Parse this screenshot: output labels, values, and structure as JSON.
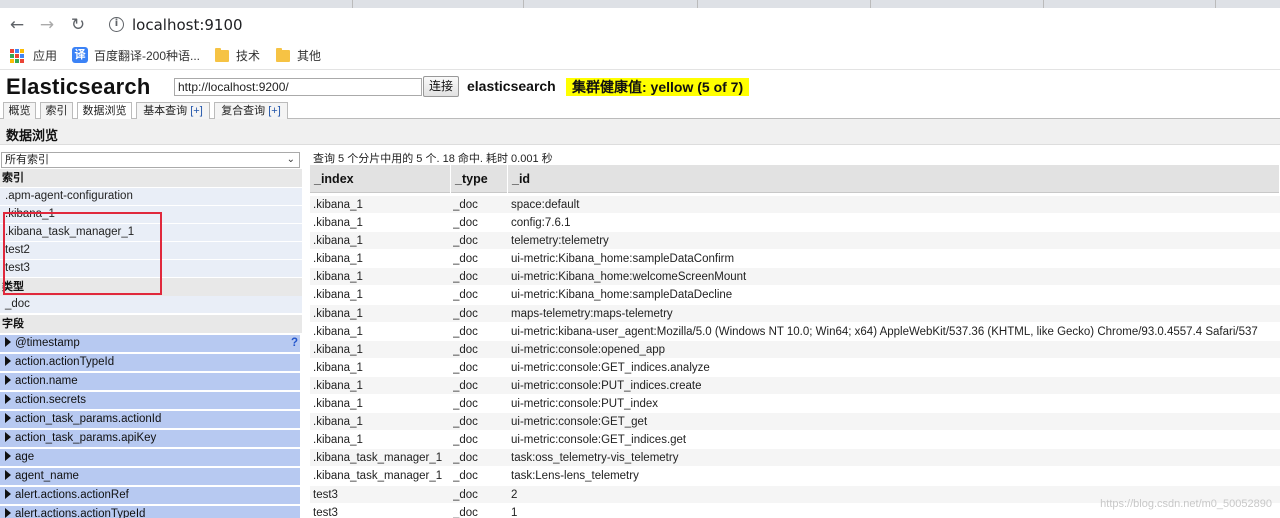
{
  "browser": {
    "back_icon": "arrow-left-icon",
    "forward_icon": "arrow-right-icon",
    "reload_icon": "reload-icon",
    "url": "localhost:9100",
    "bookmarks": [
      {
        "label": "应用",
        "icon": "apps-grid-icon"
      },
      {
        "label": "百度翻译-200种语...",
        "icon": "fanyi-icon"
      },
      {
        "label": "技术",
        "icon": "folder-icon"
      },
      {
        "label": "其他",
        "icon": "folder-icon"
      }
    ]
  },
  "header": {
    "logo": "Elasticsearch",
    "connect_url": "http://localhost:9200/",
    "connect_button": "连接",
    "cluster_name": "elasticsearch",
    "health_text": "集群健康值: yellow (5 of 7)",
    "health_color": "#ffff00"
  },
  "tabs": [
    {
      "label": "概览"
    },
    {
      "label": "索引"
    },
    {
      "label": "数据浏览",
      "active": true
    },
    {
      "label": "基本查询",
      "plus": "[+]"
    },
    {
      "label": "复合查询",
      "plus": "[+]"
    }
  ],
  "section_title": "数据浏览",
  "sidebar": {
    "index_select": "所有索引",
    "index_group": "索引",
    "indices": [
      ".apm-agent-configuration",
      ".kibana_1",
      ".kibana_task_manager_1",
      "test2",
      "test3"
    ],
    "type_group": "类型",
    "types": [
      "_doc"
    ],
    "field_group": "字段",
    "fields": [
      "@timestamp",
      "action.actionTypeId",
      "action.name",
      "action.secrets",
      "action_task_params.actionId",
      "action_task_params.apiKey",
      "age",
      "agent_name",
      "alert.actions.actionRef",
      "alert.actions.actionTypeId"
    ],
    "help_mark": "?",
    "highlight_color": "#e0283c"
  },
  "results": {
    "summary": "查询 5 个分片中用的 5 个. 18 命中. 耗时 0.001 秒",
    "columns": [
      "_index",
      "_type",
      "_id"
    ],
    "rows": [
      [
        ".kibana_1",
        "_doc",
        "space:default"
      ],
      [
        ".kibana_1",
        "_doc",
        "config:7.6.1"
      ],
      [
        ".kibana_1",
        "_doc",
        "telemetry:telemetry"
      ],
      [
        ".kibana_1",
        "_doc",
        "ui-metric:Kibana_home:sampleDataConfirm"
      ],
      [
        ".kibana_1",
        "_doc",
        "ui-metric:Kibana_home:welcomeScreenMount"
      ],
      [
        ".kibana_1",
        "_doc",
        "ui-metric:Kibana_home:sampleDataDecline"
      ],
      [
        ".kibana_1",
        "_doc",
        "maps-telemetry:maps-telemetry"
      ],
      [
        ".kibana_1",
        "_doc",
        "ui-metric:kibana-user_agent:Mozilla/5.0 (Windows NT 10.0; Win64; x64) AppleWebKit/537.36 (KHTML, like Gecko) Chrome/93.0.4557.4 Safari/537"
      ],
      [
        ".kibana_1",
        "_doc",
        "ui-metric:console:opened_app"
      ],
      [
        ".kibana_1",
        "_doc",
        "ui-metric:console:GET_indices.analyze"
      ],
      [
        ".kibana_1",
        "_doc",
        "ui-metric:console:PUT_indices.create"
      ],
      [
        ".kibana_1",
        "_doc",
        "ui-metric:console:PUT_index"
      ],
      [
        ".kibana_1",
        "_doc",
        "ui-metric:console:GET_get"
      ],
      [
        ".kibana_1",
        "_doc",
        "ui-metric:console:GET_indices.get"
      ],
      [
        ".kibana_task_manager_1",
        "_doc",
        "task:oss_telemetry-vis_telemetry"
      ],
      [
        ".kibana_task_manager_1",
        "_doc",
        "task:Lens-lens_telemetry"
      ],
      [
        "test3",
        "_doc",
        "2"
      ],
      [
        "test3",
        "_doc",
        "1"
      ]
    ]
  },
  "watermark": "https://blog.csdn.net/m0_50052890"
}
